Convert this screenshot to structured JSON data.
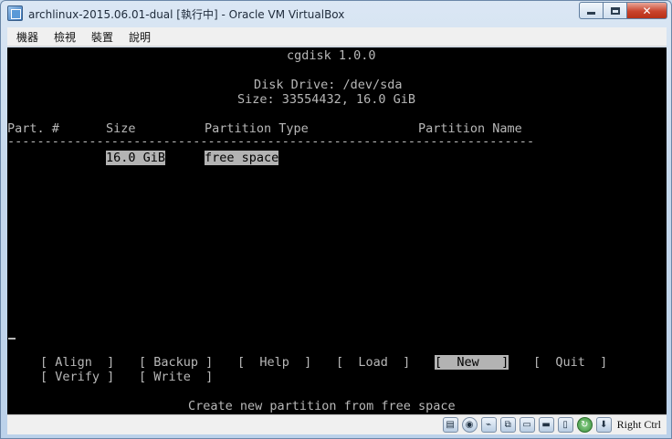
{
  "window": {
    "title": "archlinux-2015.06.01-dual [執行中] - Oracle VM VirtualBox",
    "close_label": "✕"
  },
  "menu": [
    "機器",
    "檢視",
    "裝置",
    "說明"
  ],
  "terminal": {
    "app_title": "cgdisk 1.0.0",
    "drive_line": "Disk Drive: /dev/sda",
    "size_line": "Size: 33554432, 16.0 GiB",
    "columns": {
      "part": "Part. #",
      "size": "Size",
      "type": "Partition Type",
      "name": "Partition Name"
    },
    "separator": "------------------------------------------------------------------------",
    "row": {
      "size": "16.0 GiB",
      "type": "free space"
    },
    "buttons_row1": {
      "align": "[ Align  ]",
      "backup": "[ Backup ]",
      "help": "[  Help  ]",
      "load": "[  Load  ]",
      "new": "[  New   ]",
      "quit": "[  Quit  ]"
    },
    "buttons_row2": {
      "verify": "[ Verify ]",
      "write": "[ Write  ]"
    },
    "status_message": "Create new partition from free space"
  },
  "statusbar": {
    "icons": [
      "hdd-icon",
      "optical-icon",
      "usb-icon",
      "network-icon",
      "shared-folder-icon",
      "display-icon",
      "video-capture-icon",
      "mouse-integration-icon",
      "keyboard-capture-icon"
    ],
    "host_key": "Right Ctrl"
  }
}
